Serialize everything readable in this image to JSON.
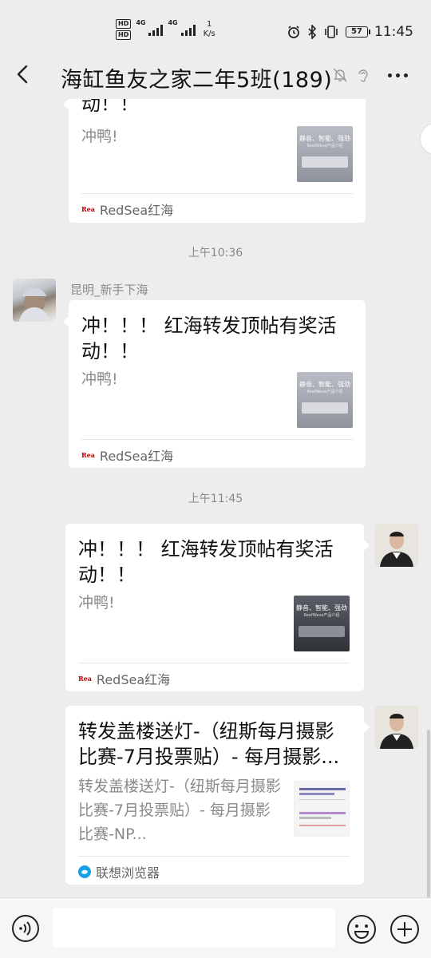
{
  "status_bar": {
    "hd1": "HD",
    "hd2": "HD",
    "net1": "4G",
    "net2": "4G",
    "speed_value": "1",
    "speed_unit": "K/s",
    "battery": "57",
    "time": "11:45"
  },
  "header": {
    "title": "海缸鱼友之家二年5班(189)"
  },
  "messages": [
    {
      "title_part": "动！！",
      "desc": "冲鸭!",
      "source": "RedSea红海",
      "thumb_line1": "静音、智能、强劲",
      "thumb_line2": "ReefWave产品介绍"
    },
    {
      "time": "上午10:36",
      "nickname": "昆明_新手下海",
      "title": "冲！！！ 红海转发顶帖有奖活动！！",
      "desc": "冲鸭!",
      "source": "RedSea红海",
      "thumb_line1": "静音、智能、强劲",
      "thumb_line2": "ReefWave产品介绍"
    },
    {
      "time": "上午11:45",
      "title": "冲！！！ 红海转发顶帖有奖活动！！",
      "desc": "冲鸭!",
      "source": "RedSea红海",
      "thumb_line1": "静音、智能、强劲",
      "thumb_line2": "ReefWave产品介绍"
    },
    {
      "title": "转发盖楼送灯-（纽斯每月摄影比赛-7月投票贴）- 每月摄影...",
      "desc": "转发盖楼送灯-（纽斯每月摄影比赛-7月投票贴）- 每月摄影比赛-NP...",
      "source": "联想浏览器"
    }
  ],
  "colors": {
    "background": "#ededed",
    "card": "#ffffff",
    "muted_text": "#8a8a8a",
    "lenovo_blue": "#1aa0e8"
  }
}
